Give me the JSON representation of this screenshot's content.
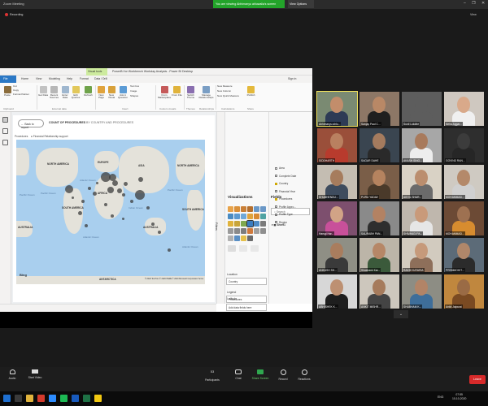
{
  "zoom": {
    "window_title": "Zoom Meeting",
    "share_banner": "You are viewing Abhimanyu ahluwalia's screen",
    "view_options": "View Options",
    "window_controls": "– ❐ ✕",
    "recording": "Recording",
    "view_label": "View"
  },
  "pbi": {
    "contextual_tab": "Visual tools",
    "title": "PowerBI for Workbench Workday Analysis - Power BI Desktop",
    "tabs": [
      "File",
      "Home",
      "View",
      "Modeling",
      "Help",
      "Format",
      "Data / Drill"
    ],
    "sign_in": "Sign in",
    "ribbon": {
      "paste": "Paste",
      "cut": "Cut",
      "copy": "Copy",
      "format_painter": "Format Painter",
      "get_data": "Get Data",
      "recent_sources": "Recent Sources",
      "enter_data": "Enter Data",
      "edit_queries": "Edit Queries",
      "refresh": "Refresh",
      "new_page": "New Page",
      "new_visual": "New Visual",
      "ask_question": "Ask A Question",
      "text_box": "Text box",
      "image": "Image",
      "shapes": "Shapes",
      "from_marketplace": "From Marketplace",
      "from_file": "From File",
      "switch_theme": "Switch Theme",
      "manage_relationships": "Manage Relationships",
      "new_measure": "New Measure",
      "new_column": "New Column",
      "new_quick_measure": "New Quick Measure",
      "publish": "Publish",
      "groups": [
        "Clipboard",
        "External data",
        "Insert",
        "Custom visuals",
        "Themes",
        "Relationships",
        "Calculations",
        "Share"
      ]
    },
    "report": {
      "back_button": "Back to report",
      "title": "COUNT OF PROCEDURES",
      "subtitle": "BY COUNTRY AND PROCEDURES",
      "procedures_label": "Procedures",
      "procedures_chip": "Financial Relationship support"
    },
    "map": {
      "regions": [
        "NORTH AMERICA",
        "EUROPE",
        "ASIA",
        "NORTH AMERICA",
        "SOUTH AMERICA",
        "AFRICA",
        "SOUTH AMERICA",
        "AUSTRALIA",
        "AUSTRALIA",
        "ANTARCTICA"
      ],
      "oceans": [
        "Pacific Ocean",
        "Atlantic Ocean",
        "Indian Ocean",
        "Pacific Ocean",
        "Atlantic Ocean",
        "Pacific Ocean",
        "Atlantic Ocean"
      ],
      "bing": "Bing",
      "credit": "© 2020 TomTom © 2020 HERE © 2020 Microsoft Corporation Terms"
    },
    "status_bar": "PAGE 1 OF 1",
    "filters_label": "Filters",
    "visualizations": {
      "title": "Visualizations",
      "wells": [
        {
          "label": "Location",
          "value": "Country"
        },
        {
          "label": "Legend",
          "value": "Procedures"
        },
        {
          "label": "Latitude",
          "value": "Add data fields here"
        },
        {
          "label": "Longitude",
          "value": "Add data fields here"
        },
        {
          "label": "Size",
          "value": ""
        }
      ]
    },
    "fields": {
      "title": "Fields",
      "search_placeholder": "Search",
      "table": "Sheet1",
      "items": [
        {
          "name": "Area",
          "checked": false
        },
        {
          "name": "Complete Date",
          "checked": false
        },
        {
          "name": "Country",
          "checked": true
        },
        {
          "name": "Financial Year",
          "checked": false
        },
        {
          "name": "Procedures",
          "checked": true
        },
        {
          "name": "Profile Appro...",
          "checked": false
        },
        {
          "name": "Profile Type",
          "checked": false
        },
        {
          "name": "Region",
          "checked": false
        }
      ]
    }
  },
  "participants": [
    {
      "name": "Abhimanyu ahlu...",
      "bg": "#7a8a72",
      "skin": "#c28d6b",
      "shirt": "#2d3b55",
      "active": true
    },
    {
      "name": "Sanjay Paul C...",
      "bg": "#8d7766",
      "skin": "#b98866",
      "shirt": "#1f1f1f",
      "active": false
    },
    {
      "name": "Sunil Lokdhe",
      "bg": "#5d5d5d",
      "skin": "#5d5d5d",
      "shirt": "#5d5d5d",
      "active": false
    },
    {
      "name": "Neha Aggar...",
      "bg": "#cfc8c0",
      "skin": "#d9a98a",
      "shirt": "#f0f0f0",
      "active": false
    },
    {
      "name": "SIDDHARTH",
      "bg": "#9a4f3a",
      "skin": "#b98060",
      "shirt": "#b83b2d",
      "active": false
    },
    {
      "name": "SAGAR DAHE",
      "bg": "#3a4550",
      "skin": "#a47b5e",
      "shirt": "#2a2a2a",
      "active": false
    },
    {
      "name": "AKASH SING...",
      "bg": "#a7a7a7",
      "skin": "#a87a5c",
      "shirt": "#ededed",
      "active": false
    },
    {
      "name": "GOVIND RAN...",
      "bg": "#2e2e2e",
      "skin": "#3c3c3c",
      "shirt": "#262626",
      "active": false
    },
    {
      "name": "SHUBHENDU...",
      "bg": "#c4bdb2",
      "skin": "#a67c5d",
      "shirt": "#3e4c5e",
      "active": false
    },
    {
      "name": "PURU YADAV",
      "bg": "#7a5e48",
      "skin": "#b5835f",
      "shirt": "#4a3a2a",
      "active": false
    },
    {
      "name": "AKHIL SHAR...",
      "bg": "#d9d2c5",
      "skin": "#bb8e6e",
      "shirt": "#6b6b6b",
      "active": false
    },
    {
      "name": "MOHAMMAD...",
      "bg": "#cfcac2",
      "skin": "#b4896a",
      "shirt": "#d0d0d0",
      "active": false
    },
    {
      "name": "Harsgi Har...",
      "bg": "#7d4f6e",
      "skin": "#d1a386",
      "shirt": "#c8509a",
      "active": false
    },
    {
      "name": "SAURABH PAN...",
      "bg": "#8a8a8a",
      "skin": "#b38263",
      "shirt": "#2e2e2e",
      "active": false
    },
    {
      "name": "SHIVANGI PA...",
      "bg": "#bfb7ad",
      "skin": "#c99a7a",
      "shirt": "#e6e6e6",
      "active": false
    },
    {
      "name": "MOHAMMAD...",
      "bg": "#6c4a35",
      "skin": "#9e7151",
      "shirt": "#d78c2f",
      "active": false
    },
    {
      "name": "ANKUSH SH...",
      "bg": "#8f8f85",
      "skin": "#a97d5e",
      "shirt": "#3a3a3a",
      "active": false
    },
    {
      "name": "Shashank Kar...",
      "bg": "#bcb5a8",
      "skin": "#b68767",
      "shirt": "#3b5a3b",
      "active": false
    },
    {
      "name": "RAKHI KATARIA",
      "bg": "#d2cbbf",
      "skin": "#c69a7b",
      "shirt": "#8e6f5a",
      "active": false
    },
    {
      "name": "PREMMOHIT...",
      "bg": "#5c6b78",
      "skin": "#b0876a",
      "shirt": "#2b2b2b",
      "active": false
    },
    {
      "name": "ABHISHEK K...",
      "bg": "#d7d7d7",
      "skin": "#bd9072",
      "shirt": "#1e1e1e",
      "active": false
    },
    {
      "name": "ANKIT MISHR...",
      "bg": "#cdc7bd",
      "skin": "#a67b5c",
      "shirt": "#444444",
      "active": false
    },
    {
      "name": "SHUBHAM K...",
      "bg": "#8d8d84",
      "skin": "#b28467",
      "shirt": "#3e6e9a",
      "active": false
    },
    {
      "name": "VIKASH KUMAR",
      "bg": "#b6aea1",
      "skin": "#a57a5b",
      "shirt": "#5a5a5a",
      "active": false
    },
    {
      "name": "Ankit Jaipurai",
      "bg": "#c0873e",
      "skin": "#9a6b45",
      "shirt": "#7a4a22",
      "active": false
    }
  ],
  "controls": {
    "audio": "Audio",
    "start_video": "Start Video",
    "participants": "Participants",
    "participants_count": "53",
    "chat": "Chat",
    "share_screen": "Share Screen",
    "record": "Record",
    "reactions": "Reactions",
    "leave": "Leave"
  },
  "taskbar": {
    "language": "ENG",
    "time": "07:55",
    "date": "10-10-2020"
  },
  "colors": {
    "zoom_green": "#23a42a",
    "leave_red": "#d72a2a",
    "pbi_blue": "#2b78c5",
    "visual_tools": "#cdeb9e",
    "map_water": "#a9cfee",
    "map_land": "#e4e2da"
  }
}
